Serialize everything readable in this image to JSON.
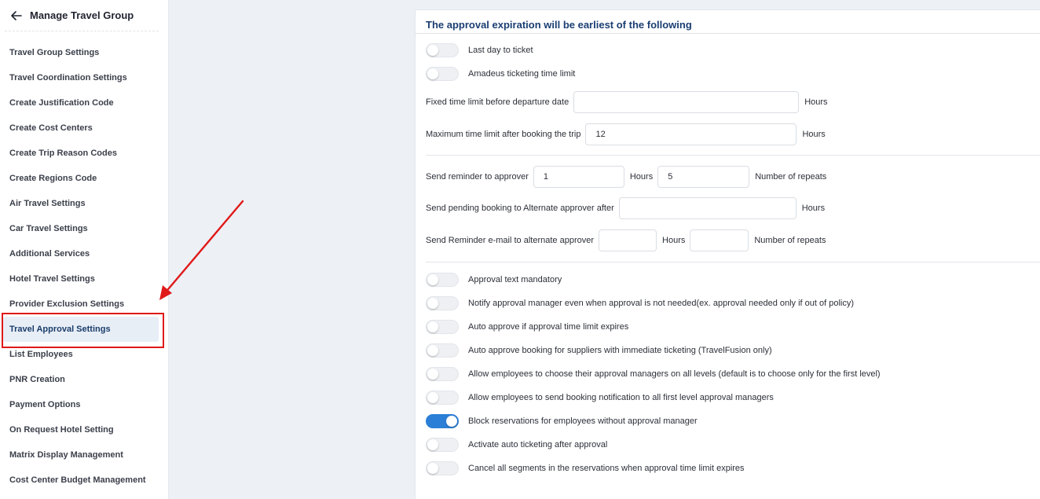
{
  "sidebar": {
    "title": "Manage Travel Group",
    "items": [
      {
        "label": "Travel Group Settings"
      },
      {
        "label": "Travel Coordination Settings"
      },
      {
        "label": "Create Justification Code"
      },
      {
        "label": "Create Cost Centers"
      },
      {
        "label": "Create Trip Reason Codes"
      },
      {
        "label": "Create Regions Code"
      },
      {
        "label": "Air Travel Settings"
      },
      {
        "label": "Car Travel Settings"
      },
      {
        "label": "Additional Services"
      },
      {
        "label": "Hotel Travel Settings"
      },
      {
        "label": "Provider Exclusion Settings"
      },
      {
        "label": "Travel Approval Settings"
      },
      {
        "label": "List Employees"
      },
      {
        "label": "PNR Creation"
      },
      {
        "label": "Payment Options"
      },
      {
        "label": "On Request Hotel Setting"
      },
      {
        "label": "Matrix Display Management"
      },
      {
        "label": "Cost Center Budget Management"
      }
    ],
    "active_item": "Travel Approval Settings"
  },
  "panel": {
    "title": "The approval expiration will be earliest of the following",
    "expiry_toggles": [
      {
        "label": "Last day to ticket",
        "on": false
      },
      {
        "label": "Amadeus ticketing time limit",
        "on": false
      }
    ],
    "fixed_limit": {
      "label": "Fixed time limit before departure date",
      "value": "",
      "unit": "Hours"
    },
    "max_limit": {
      "label": "Maximum time limit after booking the trip",
      "value": "12",
      "unit": "Hours"
    },
    "reminder": {
      "label": "Send reminder to approver",
      "hours_value": "1",
      "hours_unit": "Hours",
      "repeats_value": "5",
      "repeats_unit": "Number of repeats"
    },
    "pending": {
      "label": "Send pending booking to Alternate approver after",
      "value": "",
      "unit": "Hours"
    },
    "alt_reminder": {
      "label": "Send Reminder e-mail to alternate approver",
      "hours_value": "",
      "hours_unit": "Hours",
      "repeats_value": "",
      "repeats_unit": "Number of repeats"
    },
    "options": [
      {
        "label": "Approval text mandatory",
        "on": false
      },
      {
        "label": "Notify approval manager even when approval is not needed(ex. approval needed only if out of policy)",
        "on": false
      },
      {
        "label": "Auto approve if approval time limit expires",
        "on": false
      },
      {
        "label": "Auto approve booking for suppliers with immediate ticketing (TravelFusion only)",
        "on": false
      },
      {
        "label": "Allow employees to choose their approval managers on all levels (default is to choose only for the first level)",
        "on": false
      },
      {
        "label": "Allow employees to send booking notification to all first level approval managers",
        "on": false
      },
      {
        "label": "Block reservations for employees without approval manager",
        "on": true
      },
      {
        "label": "Activate auto ticketing after approval",
        "on": false
      },
      {
        "label": "Cancel all segments in the reservations when approval time limit expires",
        "on": false
      }
    ]
  },
  "colors": {
    "accent": "#2b7fd6",
    "title": "#1b3e72",
    "highlight": "#e01919"
  }
}
